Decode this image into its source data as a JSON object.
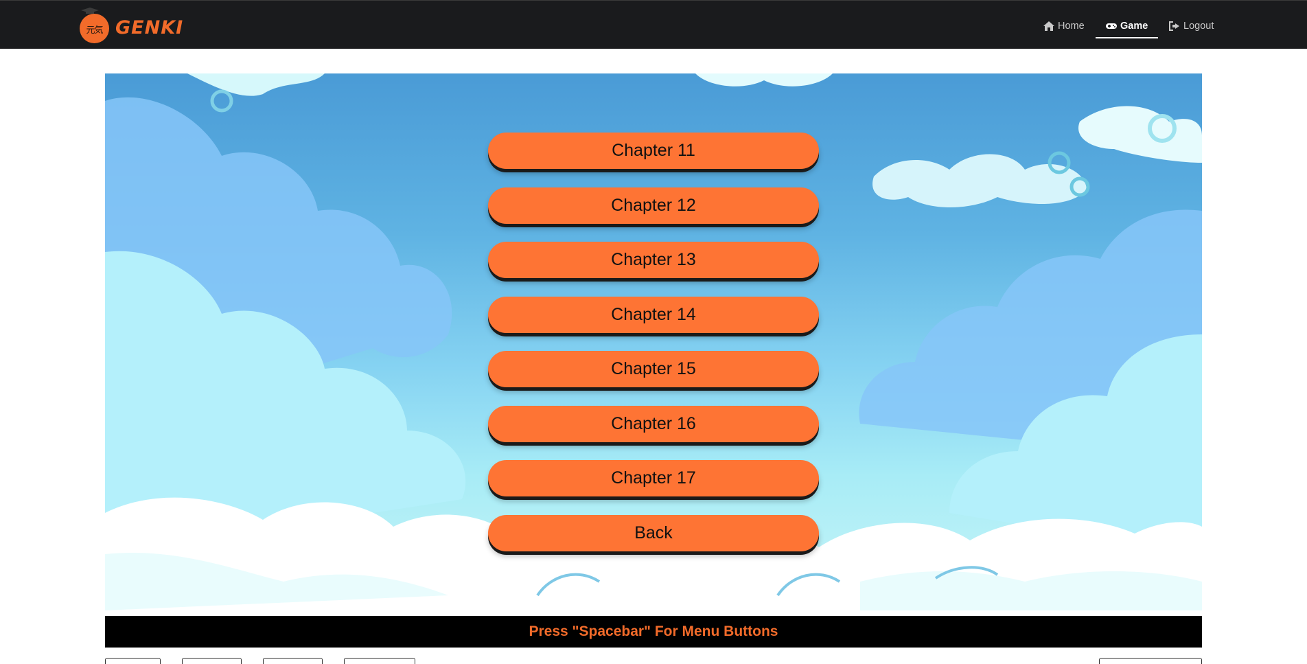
{
  "navbar": {
    "brand_name": "GENKI",
    "logo_kanji": "元気",
    "items": [
      {
        "label": "Home",
        "icon": "home-icon",
        "active": false
      },
      {
        "label": "Game",
        "icon": "gamepad-icon",
        "active": true
      },
      {
        "label": "Logout",
        "icon": "sign-out-icon",
        "active": false
      }
    ]
  },
  "menu": {
    "buttons": [
      {
        "label": "Chapter 11"
      },
      {
        "label": "Chapter 12"
      },
      {
        "label": "Chapter 13"
      },
      {
        "label": "Chapter 14"
      },
      {
        "label": "Chapter 15"
      },
      {
        "label": "Chapter 16"
      },
      {
        "label": "Chapter 17"
      },
      {
        "label": "Back"
      }
    ]
  },
  "footer": {
    "hint": "Press \"Spacebar\" For Menu Buttons"
  },
  "colors": {
    "accent": "#f26b2a",
    "button_fill": "#fe7434",
    "navbar_bg": "#1a1b1d",
    "sky_top": "#4a9bd6"
  }
}
